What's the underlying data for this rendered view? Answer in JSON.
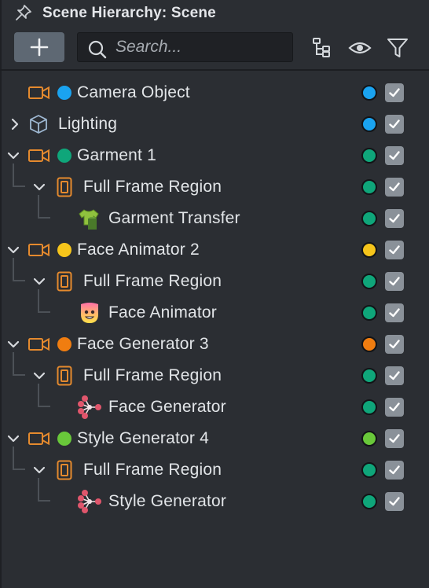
{
  "header": {
    "title": "Scene Hierarchy: Scene"
  },
  "search": {
    "placeholder": "Search..."
  },
  "colors": {
    "blue": "#1aa3f0",
    "green": "#0fa67a",
    "yellow": "#f6c51b",
    "orange": "#f07d10",
    "lime": "#69c83a",
    "camera_orange": "#e58a2e"
  },
  "rows": [
    {
      "label": "Camera Object",
      "icon": "camera-icon",
      "color": "#1aa3f0",
      "right_color": "#1aa3f0",
      "checked": true
    },
    {
      "label": "Lighting",
      "icon": "cube-icon",
      "color": "",
      "right_color": "#1aa3f0",
      "checked": true
    },
    {
      "label": "Garment 1",
      "icon": "camera-icon",
      "color": "#0fa67a",
      "right_color": "#0fa67a",
      "checked": true
    },
    {
      "label": "Full Frame Region",
      "icon": "phone-frame-icon",
      "color": "",
      "right_color": "#0fa67a",
      "checked": true
    },
    {
      "label": "Garment Transfer",
      "icon": "tshirt-icon",
      "color": "",
      "right_color": "#0fa67a",
      "checked": true
    },
    {
      "label": "Face Animator 2",
      "icon": "camera-icon",
      "color": "#f6c51b",
      "right_color": "#f6c51b",
      "checked": true
    },
    {
      "label": "Full Frame Region",
      "icon": "phone-frame-icon",
      "color": "",
      "right_color": "#0fa67a",
      "checked": true
    },
    {
      "label": "Face Animator",
      "icon": "face-animator-icon",
      "color": "",
      "right_color": "#0fa67a",
      "checked": true
    },
    {
      "label": "Face Generator 3",
      "icon": "camera-icon",
      "color": "#f07d10",
      "right_color": "#f07d10",
      "checked": true
    },
    {
      "label": "Full Frame Region",
      "icon": "phone-frame-icon",
      "color": "",
      "right_color": "#0fa67a",
      "checked": true
    },
    {
      "label": "Face Generator",
      "icon": "ml-network-icon",
      "color": "",
      "right_color": "#0fa67a",
      "checked": true
    },
    {
      "label": "Style Generator 4",
      "icon": "camera-icon",
      "color": "#69c83a",
      "right_color": "#69c83a",
      "checked": true
    },
    {
      "label": "Full Frame Region",
      "icon": "phone-frame-icon",
      "color": "",
      "right_color": "#0fa67a",
      "checked": true
    },
    {
      "label": "Style Generator",
      "icon": "ml-network-icon",
      "color": "",
      "right_color": "#0fa67a",
      "checked": true
    }
  ]
}
